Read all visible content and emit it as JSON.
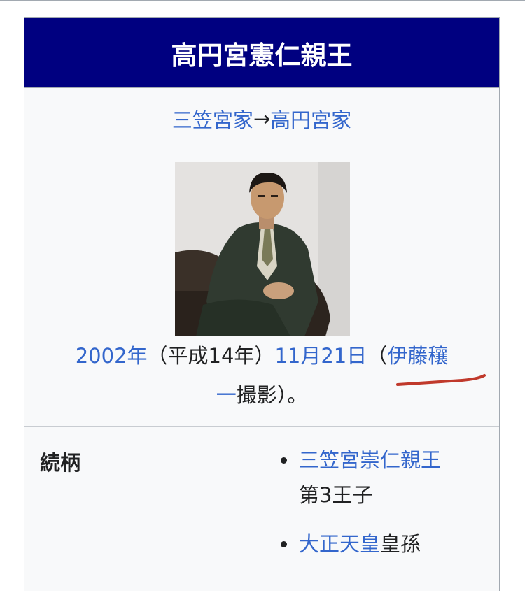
{
  "infobox": {
    "title": "高円宮憲仁親王",
    "house": {
      "from": "三笠宮家",
      "arrow": "→",
      "to": "高円宮家"
    },
    "photo": {
      "caption_date_link": "2002年",
      "caption_era": "（平成14年）",
      "caption_day_link": "11月21日",
      "caption_open_paren": "（",
      "caption_photographer_link_part1": "伊藤穰",
      "caption_photographer_link_part2": "一",
      "caption_suffix": "撮影）。"
    },
    "lineage": {
      "label": "続柄",
      "items": [
        {
          "link": "三笠宮崇仁親王",
          "text": "第3王子"
        },
        {
          "link": "大正天皇",
          "text": "皇孫"
        }
      ]
    }
  },
  "colors": {
    "title_bg": "#000080",
    "link": "#3366cc",
    "pen_mark": "#c0392b"
  }
}
